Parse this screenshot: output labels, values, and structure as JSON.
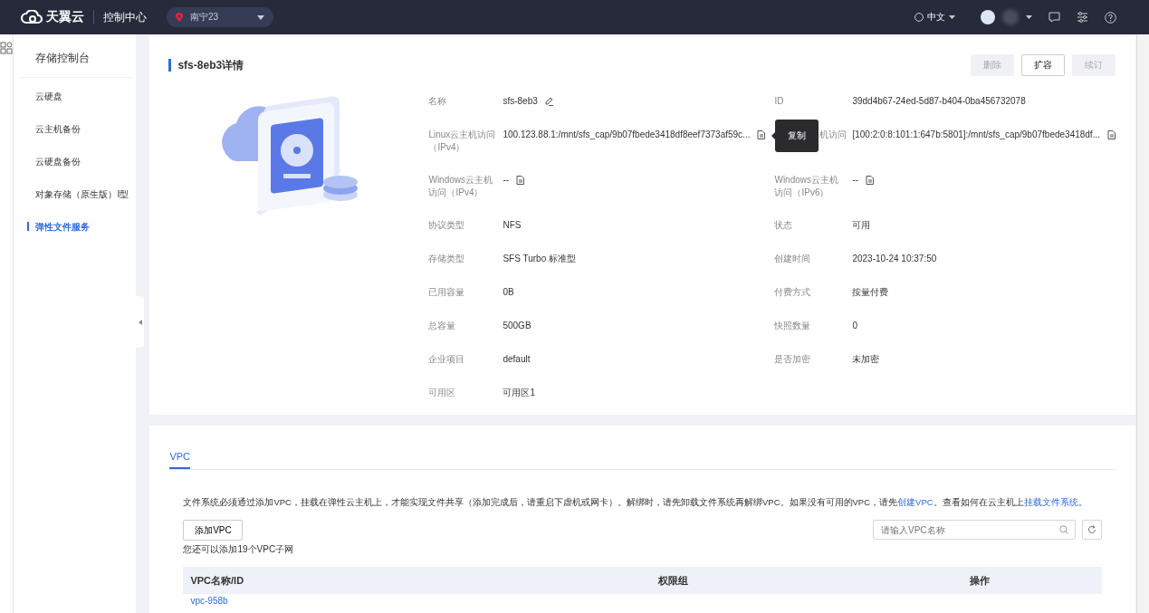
{
  "topbar": {
    "logo_text": "天翼云",
    "console": "控制中心",
    "region": "南宁23",
    "language": "中文"
  },
  "sidebar": {
    "title": "存储控制台",
    "items": [
      {
        "label": "云硬盘",
        "selected": false
      },
      {
        "label": "云主机备份",
        "selected": false
      },
      {
        "label": "云硬盘备份",
        "selected": false
      },
      {
        "label": "对象存储（原生版）Ⅰ型",
        "selected": false
      },
      {
        "label": "弹性文件服务",
        "selected": true
      }
    ]
  },
  "detail": {
    "title": "sfs-8eb3详情",
    "buttons": [
      {
        "label": "删除",
        "disabled": true
      },
      {
        "label": "扩容",
        "disabled": false
      },
      {
        "label": "续订",
        "disabled": true
      }
    ],
    "fields": [
      {
        "label": "名称",
        "value": "sfs-8eb3",
        "kind": "edit"
      },
      {
        "label": "ID",
        "value": "39dd4b67-24ed-5d87-b404-0ba456732078"
      },
      {
        "label": "Linux云主机访问（IPv4）",
        "value": "100.123.88.1:/mnt/sfs_cap/9b07fbede3418df8eef7373af59c...",
        "kind": "copy",
        "tooltip": "复制"
      },
      {
        "label": "机访问",
        "value": "[100:2:0:8:101:1:647b:5801]:/mnt/sfs_cap/9b07fbede3418df...",
        "kind": "copy",
        "covered": true
      },
      {
        "label": "Windows云主机访问（IPv4）",
        "value": "--",
        "kind": "copy"
      },
      {
        "label": "Windows云主机访问（IPv6）",
        "value": "--",
        "kind": "copy"
      },
      {
        "label": "协议类型",
        "value": "NFS"
      },
      {
        "label": "状态",
        "value": "可用"
      },
      {
        "label": "存储类型",
        "value": "SFS Turbo 标准型"
      },
      {
        "label": "创建时间",
        "value": "2023-10-24 10:37:50"
      },
      {
        "label": "已用容量",
        "value": "0B"
      },
      {
        "label": "付费方式",
        "value": "按量付费"
      },
      {
        "label": "总容量",
        "value": "500GB"
      },
      {
        "label": "快照数量",
        "value": "0"
      },
      {
        "label": "企业项目",
        "value": "default"
      },
      {
        "label": "是否加密",
        "value": "未加密"
      },
      {
        "label": "可用区",
        "value": "可用区1"
      }
    ]
  },
  "vpc": {
    "tabs": [
      {
        "label": "VPC",
        "selected": true
      }
    ],
    "notice": [
      {
        "kind": "text",
        "text": "文件系统必须通过添加VPC，挂载在弹性云主机上，才能实现文件共享（添加完成后，请重启下虚机或网卡）。解绑时，请先卸载文件系统再解绑VPC。如果没有可用的VPC，请先"
      },
      {
        "kind": "link",
        "text": "创建VPC"
      },
      {
        "kind": "text",
        "text": "。查看如何在云主机上"
      },
      {
        "kind": "link",
        "text": "挂载文件系统"
      },
      {
        "kind": "text",
        "text": "。"
      }
    ],
    "add_button": "添加VPC",
    "search": {
      "placeholder": "请输入VPC名称"
    },
    "hint": "您还可以添加19个VPC子网",
    "table": {
      "columns": [
        "VPC名称/ID",
        "权限组",
        "操作"
      ],
      "rows": [
        {
          "cells": [
            "vpc-958b"
          ]
        }
      ]
    }
  }
}
